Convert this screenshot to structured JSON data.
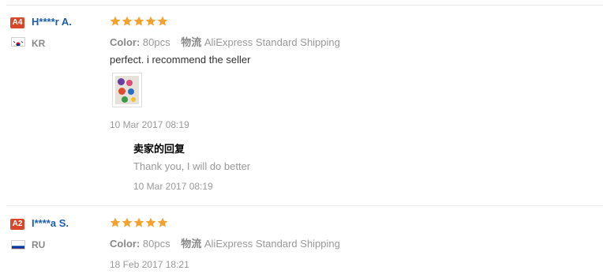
{
  "reviews": [
    {
      "badge": "A4",
      "username": "H****r A.",
      "country": "KR",
      "rating": 5,
      "color_label": "Color:",
      "color_value": "80pcs",
      "logistics_label": "物流",
      "shipping": "AliExpress Standard Shipping",
      "text": "perfect. i recommend the seller",
      "date": "10 Mar 2017 08:19",
      "reply": {
        "title": "卖家的回复",
        "text": "Thank you, I will do better",
        "date": "10 Mar 2017 08:19"
      }
    },
    {
      "badge": "A2",
      "username": "I****a S.",
      "country": "RU",
      "rating": 5,
      "color_label": "Color:",
      "color_value": "80pcs",
      "logistics_label": "物流",
      "shipping": "AliExpress Standard Shipping",
      "date": "18 Feb 2017 18:21"
    }
  ],
  "colors": {
    "badge": "#d8472a",
    "username": "#1a5dab",
    "star": "#f4a22f"
  }
}
